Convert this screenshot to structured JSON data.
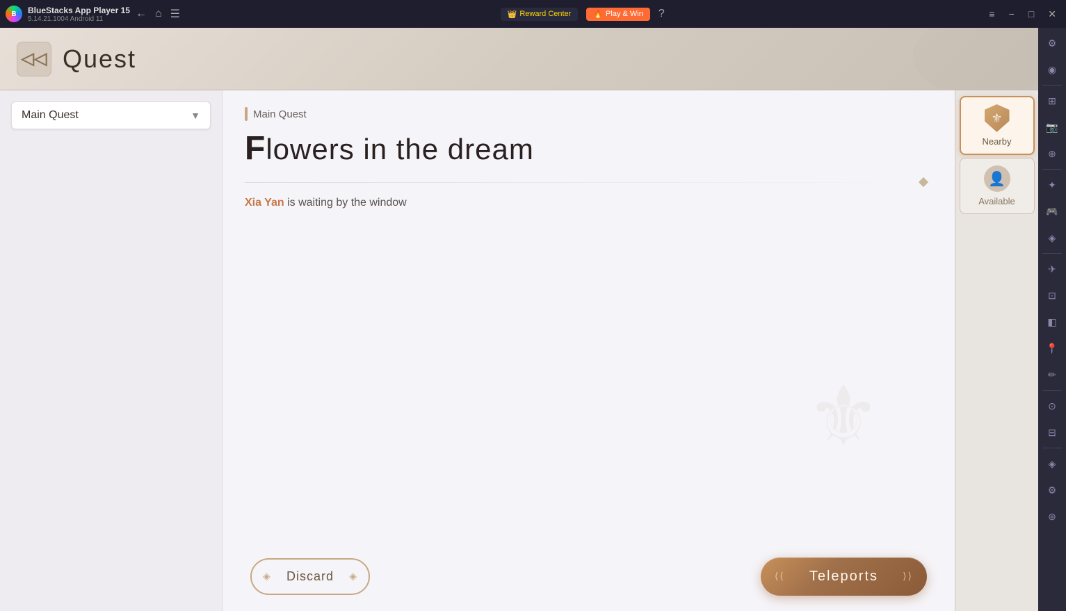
{
  "titlebar": {
    "app_name": "BlueStacks App Player 15",
    "app_version": "5.14.21.1004  Android 11",
    "reward_center_label": "Reward Center",
    "play_win_label": "Play & Win",
    "nav": {
      "back_icon": "←",
      "home_icon": "⌂",
      "menu_icon": "☰"
    },
    "window_controls": {
      "help": "?",
      "settings": "≡",
      "minimize": "−",
      "restore": "□",
      "close": "✕"
    }
  },
  "quest": {
    "header_title": "Quest",
    "quest_type": "Main Quest",
    "quest_category": "Main Quest",
    "quest_name_first": "F",
    "quest_name_rest": "lowers in the dream",
    "npc_name": "Xia Yan",
    "npc_action": "is waiting by the window",
    "discard_label": "Discard",
    "teleports_label": "Teleports"
  },
  "sidebar": {
    "nearby_label": "Nearby",
    "available_label": "Available",
    "nearby_icon": "🛡",
    "available_icon": "👤"
  },
  "bs_tools": [
    {
      "icon": "⚙",
      "name": "settings-tool"
    },
    {
      "icon": "◉",
      "name": "macro-tool"
    },
    {
      "icon": "⊞",
      "name": "multi-instance-tool"
    },
    {
      "icon": "📷",
      "name": "screenshot-tool"
    },
    {
      "icon": "⊕",
      "name": "eco-tool"
    },
    {
      "icon": "✦",
      "name": "controls-tool"
    },
    {
      "icon": "🎮",
      "name": "gamepad-tool"
    },
    {
      "icon": "◈",
      "name": "keymapping-tool"
    },
    {
      "icon": "✈",
      "name": "flight-tool"
    },
    {
      "icon": "⊡",
      "name": "window-tool"
    },
    {
      "icon": "◧",
      "name": "media-tool"
    },
    {
      "icon": "📍",
      "name": "location-tool"
    },
    {
      "icon": "✏",
      "name": "edit-tool"
    },
    {
      "icon": "⊙",
      "name": "camera-tool"
    },
    {
      "icon": "⊟",
      "name": "video-tool"
    },
    {
      "icon": "◈",
      "name": "other-tool1"
    },
    {
      "icon": "⚙",
      "name": "other-tool2"
    },
    {
      "icon": "⊛",
      "name": "other-tool3"
    }
  ]
}
